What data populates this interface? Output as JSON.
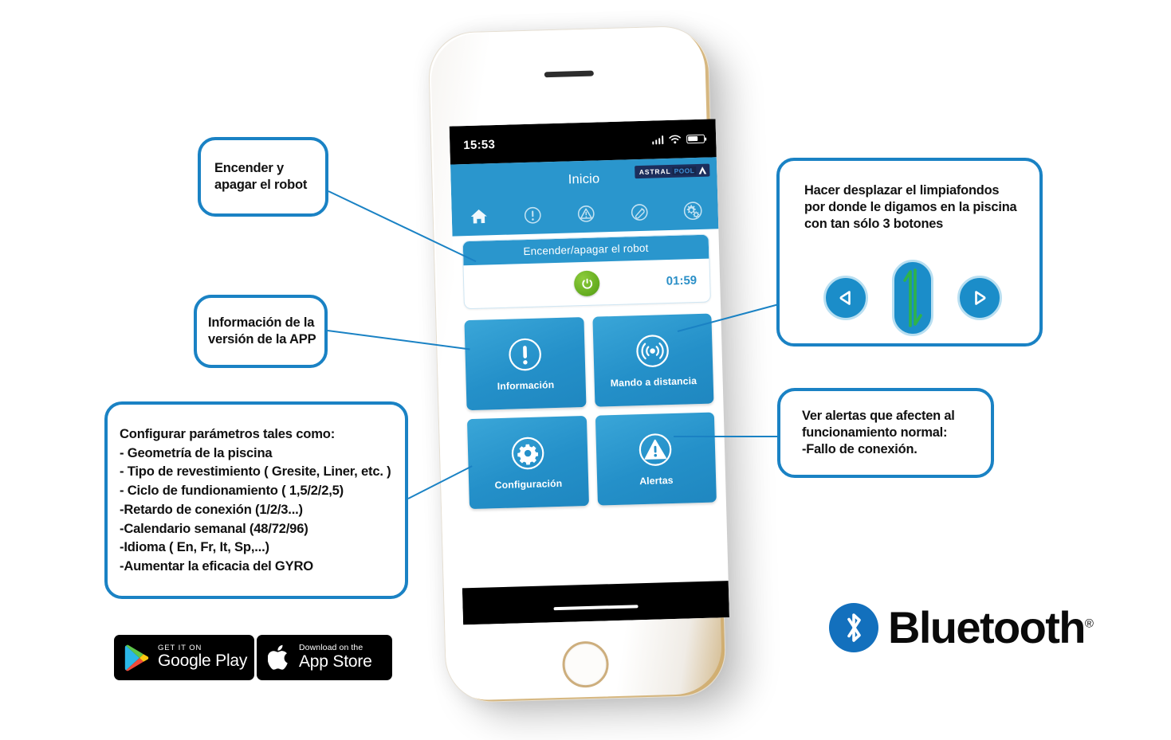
{
  "callouts": {
    "power": {
      "text": "Encender y\napagar el robot"
    },
    "info": {
      "text": "Información de la\nversión de la APP"
    },
    "config": {
      "text": "Configurar parámetros tales como:\n- Geometría de la piscina\n- Tipo de revestimiento ( Gresite, Liner, etc. )\n- Ciclo de fundionamiento ( 1,5/2/2,5)\n-Retardo de conexión (1/2/3...)\n-Calendario semanal (48/72/96)\n-Idioma ( En, Fr, It, Sp,...)\n-Aumentar la eficacia del GYRO"
    },
    "remote": {
      "text": "Hacer desplazar el limpiafondos\npor donde le digamos en la piscina\ncon tan sólo 3 botones",
      "buttons": [
        {
          "name": "left-arrow-button",
          "icon": "triangle-left-icon"
        },
        {
          "name": "up-down-arrow-button",
          "icon": "double-arrow-vertical-icon"
        },
        {
          "name": "right-arrow-button",
          "icon": "triangle-right-icon"
        }
      ]
    },
    "alerts": {
      "text": "Ver alertas que afecten al\nfuncionamiento normal:\n-Fallo de conexión."
    }
  },
  "phone": {
    "status_bar": {
      "time": "15:53",
      "signal": "signal-bars-icon",
      "wifi": "wifi-icon",
      "battery": "battery-icon"
    },
    "app": {
      "header": {
        "title": "Inicio",
        "brand_primary": "ASTRAL",
        "brand_secondary": "POOL",
        "brand_icon": "astralpool-triangle-icon"
      },
      "nav_items": [
        {
          "name": "nav-home",
          "icon": "home-icon",
          "active": true
        },
        {
          "name": "nav-information",
          "icon": "exclamation-circle-icon",
          "active": false
        },
        {
          "name": "nav-alerts",
          "icon": "warning-triangle-icon",
          "active": false
        },
        {
          "name": "nav-remote",
          "icon": "remote-signal-icon",
          "active": false
        },
        {
          "name": "nav-settings",
          "icon": "gears-icon",
          "active": false
        }
      ],
      "power_card": {
        "title": "Encender/apagar el robot",
        "button_icon": "power-icon",
        "timer": "01:59"
      },
      "tiles": [
        {
          "label": "Información",
          "icon": "exclamation-circle-icon"
        },
        {
          "label": "Mando a distancia",
          "icon": "remote-waves-icon"
        },
        {
          "label": "Configuración",
          "icon": "gear-circle-icon"
        },
        {
          "label": "Alertas",
          "icon": "warning-triangle-circle-icon"
        }
      ]
    }
  },
  "store_badges": {
    "google": {
      "small": "GET IT ON",
      "big": "Google Play",
      "icon": "google-play-icon"
    },
    "apple": {
      "small": "Download on the",
      "big": "App Store",
      "icon": "apple-icon"
    }
  },
  "bluetooth": {
    "word": "Bluetooth",
    "registered": "®",
    "icon": "bluetooth-icon"
  },
  "colors": {
    "callout_border": "#1a82c4",
    "app_blue": "#2a96cd",
    "tile_blue": "#2490c9",
    "power_green": "#63ab1e",
    "brand_navy": "#1c2e5c",
    "bluetooth_blue": "#1370bd",
    "timer_blue": "#2a8fc7"
  }
}
